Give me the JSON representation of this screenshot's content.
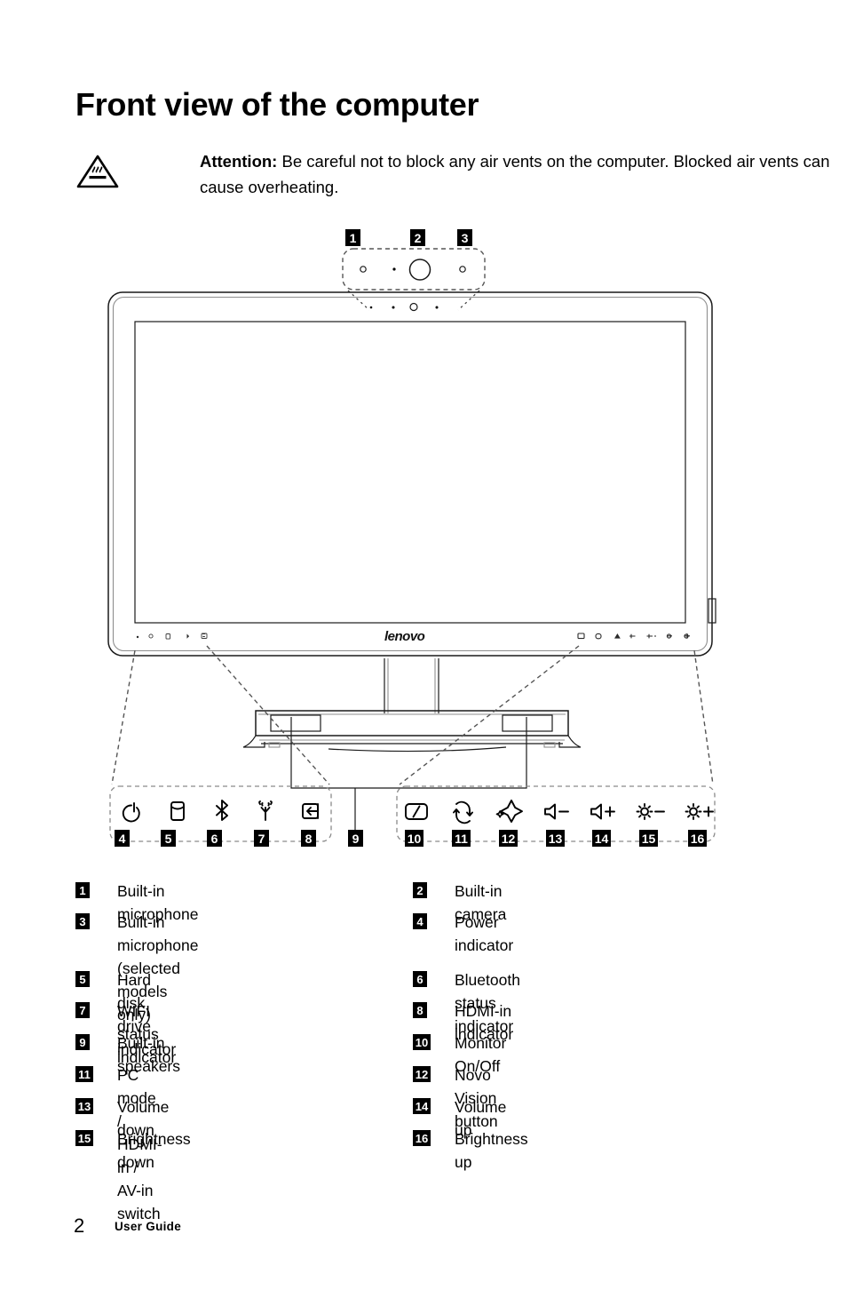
{
  "document": {
    "heading": "Front view of the computer",
    "attention_label": "Attention:",
    "attention_body": " Be careful not to block any air vents on the computer. Blocked air vents can cause overheating.",
    "warning_icon": "hot-surface-warning-icon",
    "brand_logo": "lenovo"
  },
  "diagram": {
    "top_callouts": [
      {
        "number": "1",
        "icon": "built-in-microphone-dot"
      },
      {
        "number": "2",
        "icon": "built-in-camera-circle"
      },
      {
        "number": "3",
        "icon": "built-in-microphone-dot"
      }
    ],
    "left_panel_callouts": [
      {
        "number": "4",
        "icon": "power-icon"
      },
      {
        "number": "5",
        "icon": "hard-disk-icon"
      },
      {
        "number": "6",
        "icon": "bluetooth-icon"
      },
      {
        "number": "7",
        "icon": "wifi-icon"
      },
      {
        "number": "8",
        "icon": "hdmi-in-icon"
      }
    ],
    "speaker_callout": {
      "number": "9",
      "icon": "built-in-speakers"
    },
    "right_panel_callouts": [
      {
        "number": "10",
        "icon": "monitor-on-off-icon"
      },
      {
        "number": "11",
        "icon": "input-switch-icon"
      },
      {
        "number": "12",
        "icon": "novo-vision-sparkle-icon"
      },
      {
        "number": "13",
        "icon": "volume-down-icon"
      },
      {
        "number": "14",
        "icon": "volume-up-icon"
      },
      {
        "number": "15",
        "icon": "brightness-down-icon"
      },
      {
        "number": "16",
        "icon": "brightness-up-icon"
      }
    ]
  },
  "legend": {
    "left": [
      {
        "number": "1",
        "label": "Built-in microphone"
      },
      {
        "number": "3",
        "label": "Built-in microphone (selected\nmodels only)"
      },
      {
        "number": "5",
        "label": "Hard disk drive indicator"
      },
      {
        "number": "7",
        "label": "WIFI status indicator"
      },
      {
        "number": "9",
        "label": "Built-in speakers"
      },
      {
        "number": "11",
        "label": "PC mode / HDMI-in / AV-in switch"
      },
      {
        "number": "13",
        "label": "Volume down"
      },
      {
        "number": "15",
        "label": "Brightness down"
      }
    ],
    "right": [
      {
        "number": "2",
        "label": "Built-in camera"
      },
      {
        "number": "4",
        "label": "Power indicator"
      },
      {
        "number": "6",
        "label": "Bluetooth status indicator"
      },
      {
        "number": "8",
        "label": "HDMI-in indicator"
      },
      {
        "number": "10",
        "label": "Monitor On/Off"
      },
      {
        "number": "12",
        "label": "Novo Vision button"
      },
      {
        "number": "14",
        "label": "Volume up"
      },
      {
        "number": "16",
        "label": "Brightness up"
      }
    ]
  },
  "footer": {
    "page_number": "2",
    "guide_label": "User Guide"
  },
  "colors": {
    "ink": "#000000",
    "paper": "#ffffff",
    "line": "#1a1a1a",
    "soft_line": "#9a9a9a"
  }
}
